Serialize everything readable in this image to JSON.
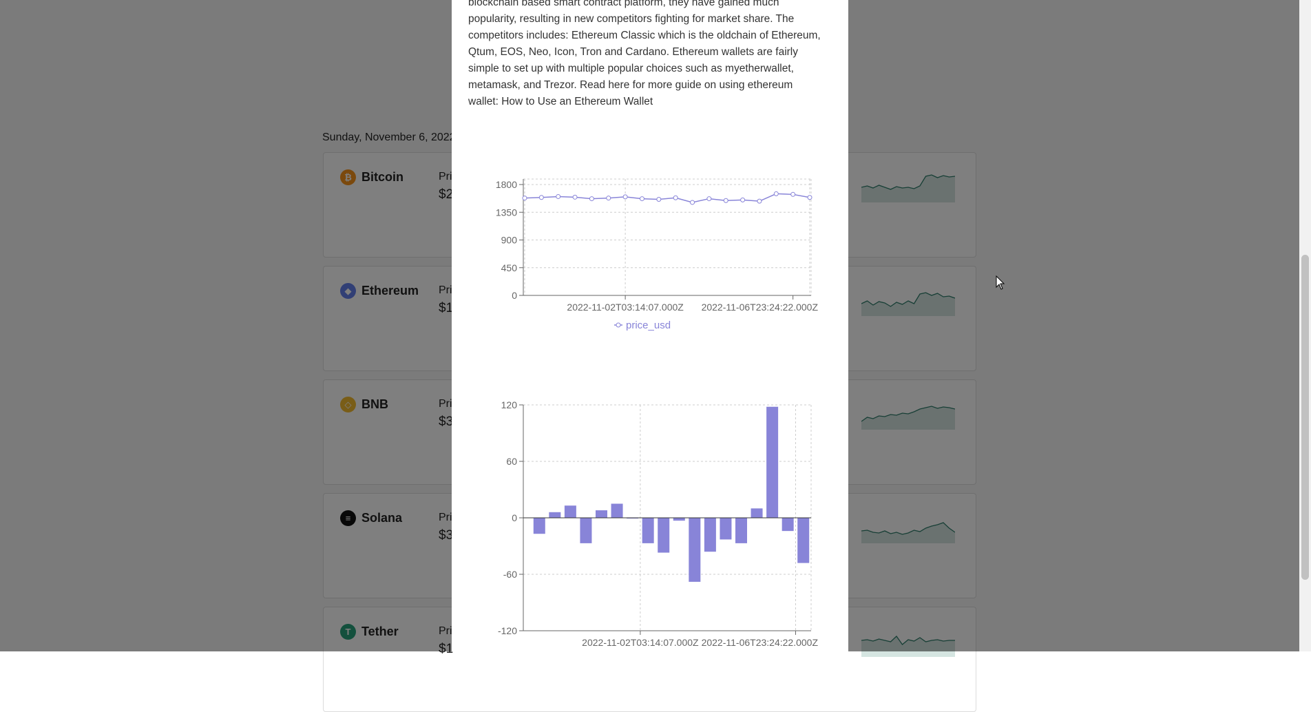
{
  "background": {
    "date_heading": "Sunday, November 6, 2022",
    "coins": [
      {
        "name": "Bitcoin",
        "price_label": "Price",
        "price": "$2",
        "icon": "bitcoin-icon",
        "icon_color": "#f7931a",
        "glyph": "₿"
      },
      {
        "name": "Ethereum",
        "price_label": "Price",
        "price": "$1",
        "icon": "ethereum-icon",
        "icon_color": "#627eea",
        "glyph": "◆"
      },
      {
        "name": "BNB",
        "price_label": "Price",
        "price": "$3",
        "icon": "bnb-icon",
        "icon_color": "#f3ba2f",
        "glyph": "◇"
      },
      {
        "name": "Solana",
        "price_label": "Price",
        "price": "$3",
        "icon": "solana-icon",
        "icon_color": "#111111",
        "glyph": "≡"
      },
      {
        "name": "Tether",
        "price_label": "Price",
        "price": "$1",
        "icon": "tether-icon",
        "icon_color": "#26a17b",
        "glyph": "T"
      }
    ],
    "sparkline_color": "#2e7d6b"
  },
  "modal": {
    "description_lines": [
      "blockchain based smart contract platform, they have gained much",
      "popularity, resulting in new competitors fighting for market share. The",
      "competitors includes: Ethereum Classic which is the oldchain of Ethereum,",
      "Qtum, EOS, Neo, Icon, Tron and Cardano. Ethereum wallets are fairly",
      "simple to set up with multiple popular choices such as myetherwallet,",
      "metamask, and Trezor. Read here for more guide on using ethereum",
      "wallet: How to Use an Ethereum Wallet"
    ]
  },
  "chart_data": [
    {
      "type": "line",
      "series": [
        {
          "name": "price_usd",
          "values": [
            1580,
            1590,
            1605,
            1595,
            1570,
            1580,
            1600,
            1570,
            1560,
            1585,
            1510,
            1570,
            1540,
            1550,
            1530,
            1650,
            1640,
            1590
          ]
        }
      ],
      "x_tick_labels": [
        "2022-11-02T03:14:07.000Z",
        "2022-11-06T23:24:22.000Z"
      ],
      "y_ticks": [
        "0",
        "450",
        "900",
        "1350",
        "1800"
      ],
      "ylim": [
        0,
        1800
      ],
      "legend": {
        "label": "price_usd",
        "placement": "bottom"
      },
      "color": "#8884d8",
      "grid": true
    },
    {
      "type": "bar",
      "series": [
        {
          "values": [
            -17,
            6,
            13,
            -27,
            8,
            15,
            0,
            -27,
            -37,
            -3,
            -68,
            -36,
            -23,
            -27,
            10,
            118,
            -14,
            -48
          ]
        }
      ],
      "x_tick_labels": [
        "2022-11-02T03:14:07.000Z",
        "2022-11-06T23:24:22.000Z"
      ],
      "y_ticks": [
        "-120",
        "-60",
        "0",
        "60",
        "120"
      ],
      "ylim": [
        -120,
        120
      ],
      "color": "#8884d8",
      "grid": true
    }
  ]
}
